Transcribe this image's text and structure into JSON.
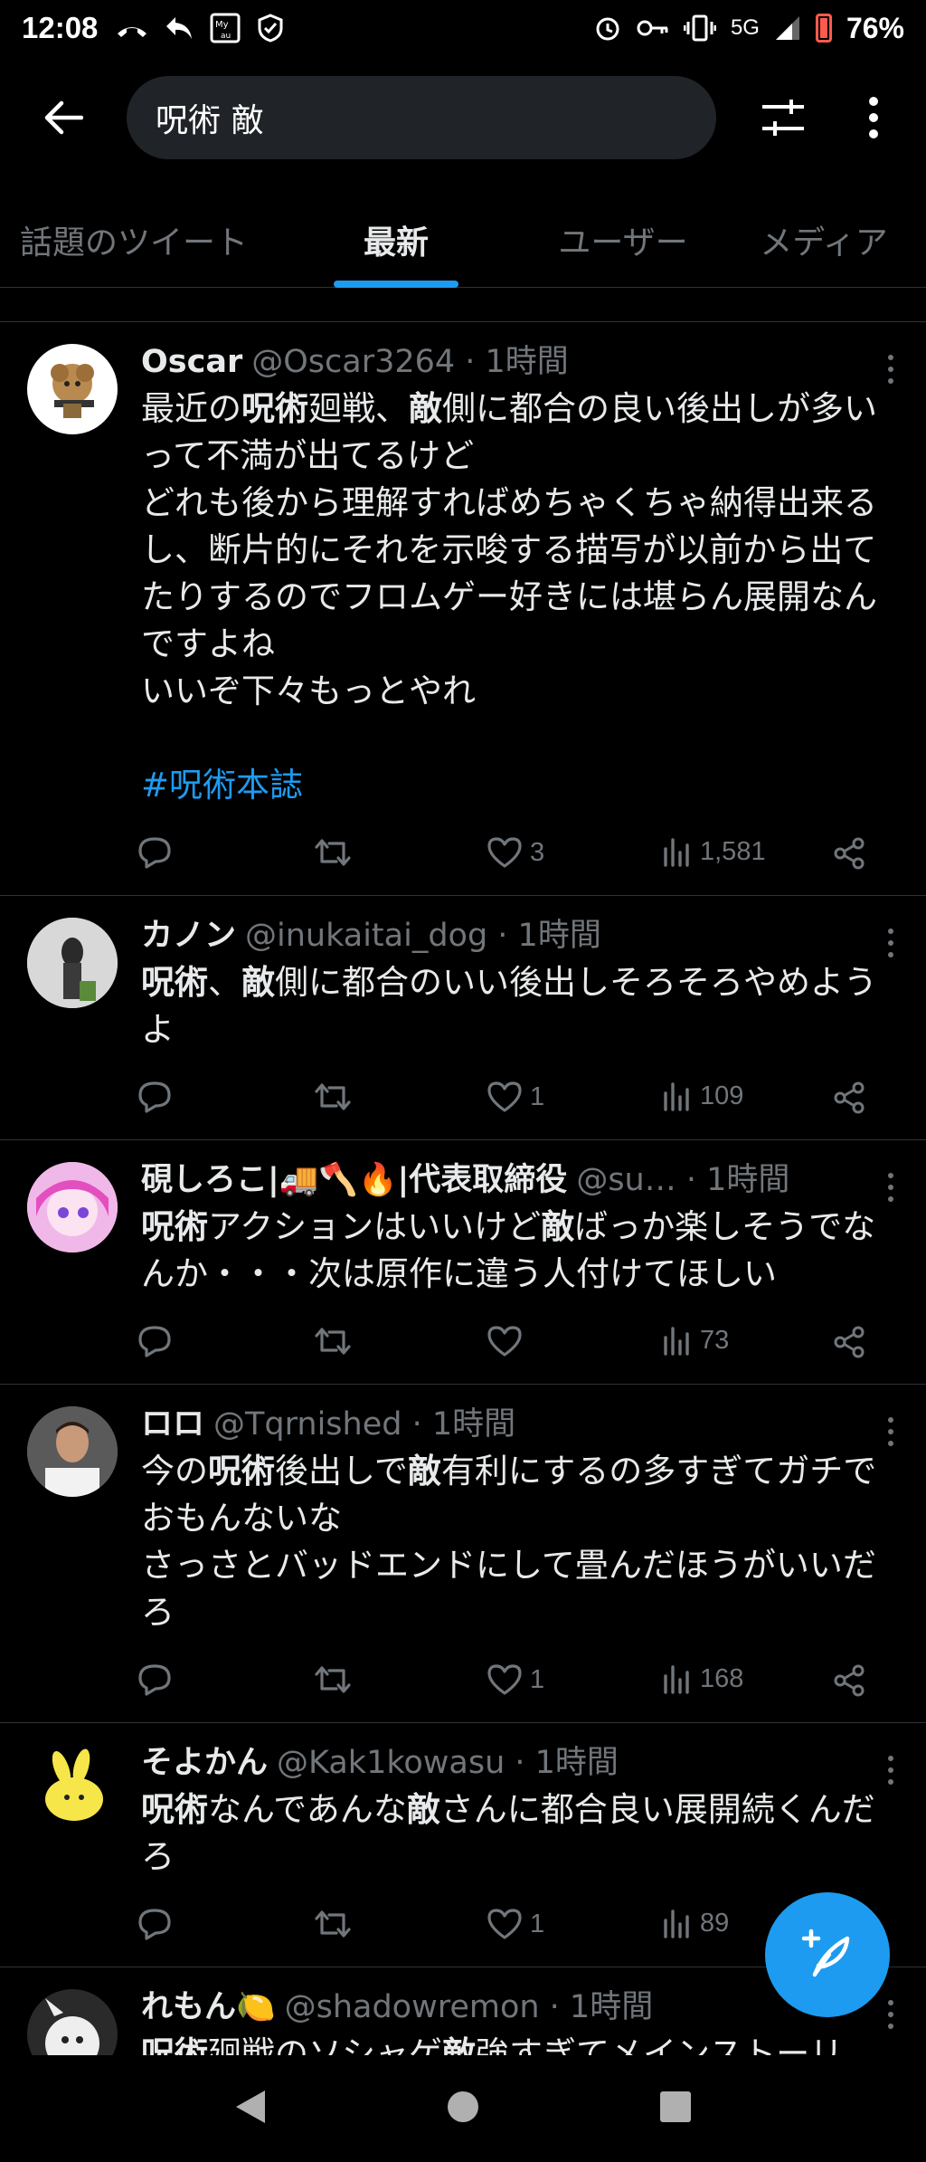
{
  "status": {
    "time": "12:08",
    "network": "5G",
    "battery": "76%",
    "icons_left": [
      "missed-call-icon",
      "reply-icon",
      "my-au-icon",
      "shield-icon"
    ],
    "icons_right": [
      "alarm-icon",
      "key-icon",
      "vibrate-icon",
      "signal-icon",
      "battery-icon"
    ]
  },
  "header": {
    "search_value": "呪術 敵"
  },
  "tabs": [
    {
      "label": "話題のツイート",
      "active": false
    },
    {
      "label": "最新",
      "active": true
    },
    {
      "label": "ユーザー",
      "active": false
    },
    {
      "label": "メディア",
      "active": false
    }
  ],
  "tweets": [
    {
      "name": "Oscar",
      "handle": "@Oscar3264 · 1時間",
      "body_html": "最近の<b>呪術</b>廻戦、<b>敵</b>側に都合の良い後出しが多いって不満が出てるけど\nどれも後から理解すればめちゃくちゃ納得出来るし、断片的にそれを示唆する描写が以前から出てたりするのでフロムゲー好きには堪らん展開なんですよね\nいいぞ下々もっとやれ",
      "hashtag": "#呪術本誌",
      "likes": "3",
      "views": "1,581"
    },
    {
      "name": "カノン",
      "handle": "@inukaitai_dog · 1時間",
      "body_html": "<b>呪術</b>、<b>敵</b>側に都合のいい後出しそろそろやめようよ",
      "hashtag": "",
      "likes": "1",
      "views": "109"
    },
    {
      "name": "硯しろこ|🚚🪓🔥|代表取締役",
      "handle": "@su…  · 1時間",
      "body_html": "<b>呪術</b>アクションはいいけど<b>敵</b>ばっか楽しそうでなんか・・・次は原作に違う人付けてほしい",
      "hashtag": "",
      "likes": "",
      "views": "73"
    },
    {
      "name": "ロロ",
      "handle": "@Tqrnished · 1時間",
      "body_html": "今の<b>呪術</b>後出しで<b>敵</b>有利にするの多すぎてガチでおもんないな\nさっさとバッドエンドにして畳んだほうがいいだろ",
      "hashtag": "",
      "likes": "1",
      "views": "168"
    },
    {
      "name": "そよかん",
      "handle": "@Kak1kowasu · 1時間",
      "body_html": "<b>呪術</b>なんであんな<b>敵</b>さんに都合良い展開続くんだろ",
      "hashtag": "",
      "likes": "1",
      "views": "89"
    },
    {
      "name": "れもん🍋",
      "handle": "@shadowremon · 1時間",
      "body_html": "<b>呪術</b>廻戦のソシャゲ<b>敵</b>強すぎてメインストーリ",
      "hashtag": "",
      "likes": "",
      "views": ""
    }
  ],
  "fab_icon": "compose-tweet-icon",
  "colors": {
    "accent": "#1d9bf0",
    "background": "#000000",
    "secondary_text": "#71767b"
  }
}
